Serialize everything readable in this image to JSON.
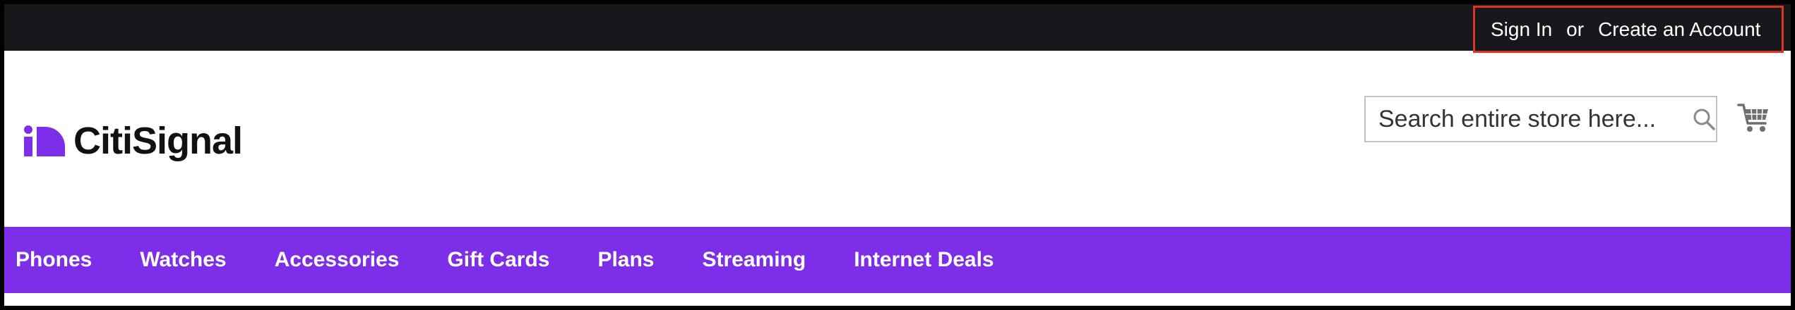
{
  "topbar": {
    "sign_in": "Sign In",
    "or": "or",
    "create_account": "Create an Account"
  },
  "brand": {
    "name": "CitiSignal",
    "accent": "#7d2ee8"
  },
  "search": {
    "placeholder": "Search entire store here...",
    "value": ""
  },
  "icons": {
    "search": "search-icon",
    "cart": "cart-icon",
    "logo_mark": "logo-mark"
  },
  "nav": {
    "items": [
      {
        "label": "Phones"
      },
      {
        "label": "Watches"
      },
      {
        "label": "Accessories"
      },
      {
        "label": "Gift Cards"
      },
      {
        "label": "Plans"
      },
      {
        "label": "Streaming"
      },
      {
        "label": "Internet Deals"
      }
    ]
  },
  "colors": {
    "topbar": "#17181c",
    "nav": "#7d2ee8",
    "highlight": "#e0321f"
  }
}
